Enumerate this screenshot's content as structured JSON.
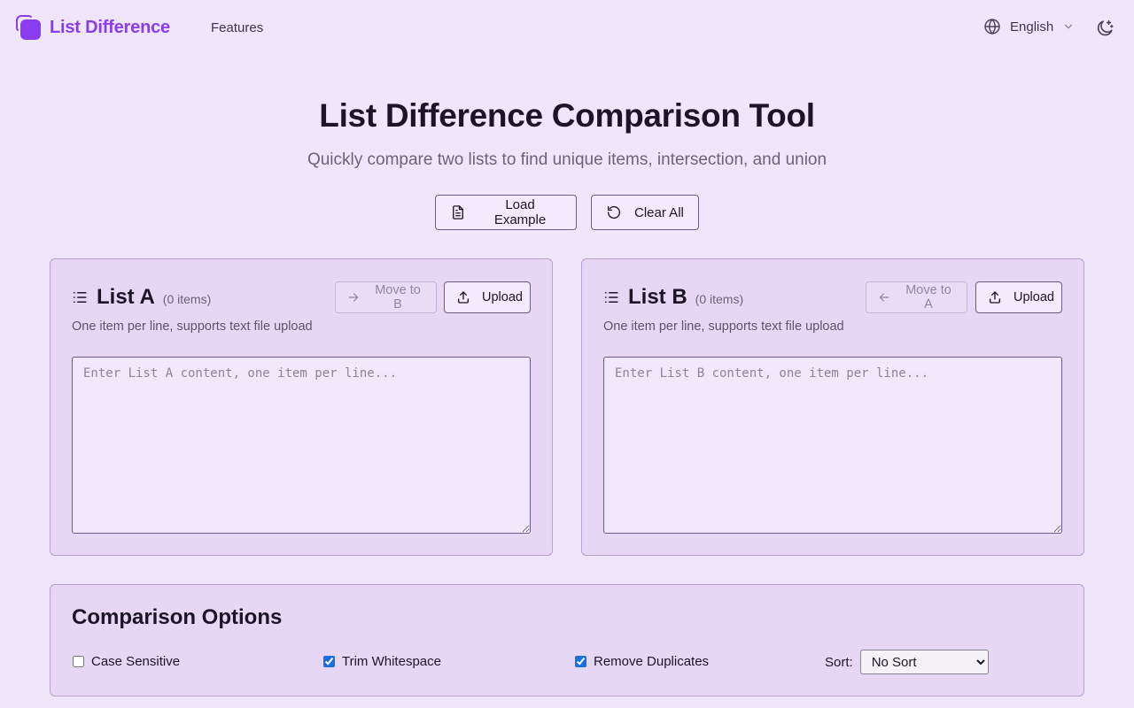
{
  "header": {
    "brand": "List Difference",
    "nav_features": "Features",
    "language": "English",
    "icons": {
      "logo": "layers-icon",
      "globe": "globe-icon",
      "chevron": "chevron-down-icon",
      "theme": "moon-sparkle-icon"
    }
  },
  "hero": {
    "title": "List Difference Comparison Tool",
    "subtitle": "Quickly compare two lists to find unique items, intersection, and union",
    "load_example_label": "Load Example",
    "clear_all_label": "Clear All"
  },
  "list_a": {
    "title": "List A",
    "count": "(0 items)",
    "description": "One item per line, supports text file upload",
    "move_label": "Move to B",
    "upload_label": "Upload",
    "placeholder": "Enter List A content, one item per line...",
    "value": ""
  },
  "list_b": {
    "title": "List B",
    "count": "(0 items)",
    "description": "One item per line, supports text file upload",
    "move_label": "Move to A",
    "upload_label": "Upload",
    "placeholder": "Enter List B content, one item per line...",
    "value": ""
  },
  "options": {
    "title": "Comparison Options",
    "case_sensitive": {
      "label": "Case Sensitive",
      "checked": false
    },
    "trim_whitespace": {
      "label": "Trim Whitespace",
      "checked": true
    },
    "remove_duplicates": {
      "label": "Remove Duplicates",
      "checked": true
    },
    "sort_label": "Sort:",
    "sort_selected": "No Sort"
  },
  "colors": {
    "accent": "#8a3df0",
    "background": "#f0e6fb",
    "card": "#e6d8f4",
    "checkbox": "#1a6fe0"
  }
}
